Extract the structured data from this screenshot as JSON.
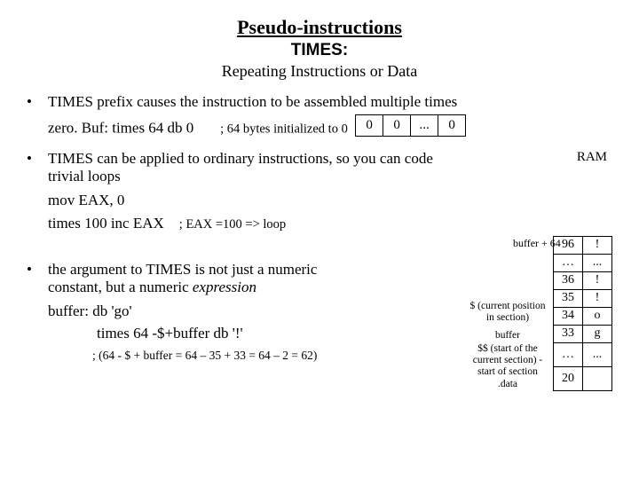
{
  "title": "Pseudo-instructions",
  "subtitle": "TIMES:",
  "subhead": "Repeating Instructions or Data",
  "b1": {
    "line1": "TIMES prefix causes the instruction to be assembled multiple times",
    "code1a": "zero. Buf:   times 64 db 0",
    "code1b": "; 64 bytes initialized to 0",
    "bytes": [
      "0",
      "0",
      "...",
      "0"
    ]
  },
  "b2": {
    "line1": "TIMES can be applied to ordinary instructions, so you can code",
    "line2": "trivial loops",
    "code1": "mov EAX, 0",
    "code2a": "times 100 inc EAX",
    "code2b": "; EAX =100 => loop"
  },
  "ram": {
    "label": "RAM",
    "buf64": "buffer + 64",
    "anno_dollar": "$ (current position in section)",
    "anno_buffer": "buffer",
    "anno_dd": "$$ (start of the current section) - start of section .data",
    "rows": [
      {
        "a": "96",
        "v": "!"
      },
      {
        "a": "…",
        "v": "..."
      },
      {
        "a": "36",
        "v": "!"
      },
      {
        "a": "35",
        "v": "!"
      },
      {
        "a": "34",
        "v": "o"
      },
      {
        "a": "33",
        "v": "g"
      },
      {
        "a": "…",
        "v": "..."
      },
      {
        "a": "20",
        "v": ""
      }
    ]
  },
  "b3": {
    "line1a": "the argument to TIMES is not just a numeric",
    "line1b": "constant, but a numeric ",
    "line1c": "expression",
    "code1": "buffer:   db 'go'",
    "code2": "times 64 -$+buffer db '!'",
    "note": "; (64 - $ + buffer = 64 – 35 + 33 = 64 – 2 = 62)"
  }
}
